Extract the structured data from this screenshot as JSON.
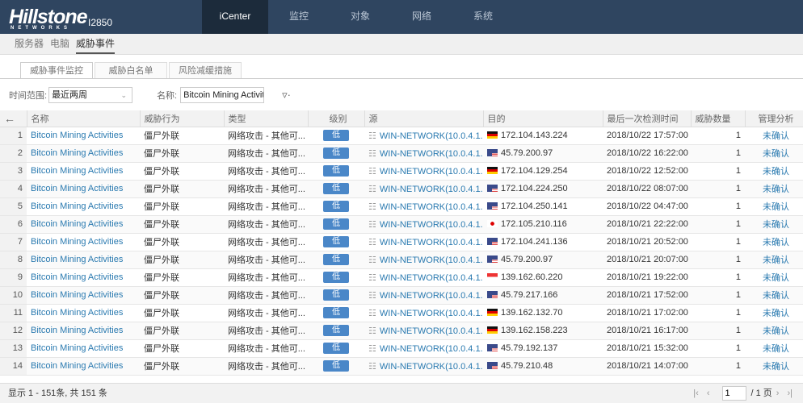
{
  "header": {
    "logo": "Hillstone",
    "logo_sub": "NETWORKS",
    "model": "I2850",
    "nav": [
      "iCenter",
      "监控",
      "对象",
      "网络",
      "系统"
    ],
    "active_nav": 0
  },
  "subnav": {
    "items": [
      "服务器",
      "电脑",
      "威胁事件"
    ],
    "active": 2
  },
  "tabs": {
    "items": [
      "威胁事件监控",
      "威胁白名单",
      "风险减缓措施"
    ],
    "active": 0
  },
  "filter": {
    "time_label": "时间范围:",
    "time_value": "最近两周",
    "name_label": "名称:",
    "name_value": "Bitcoin Mining Activities",
    "filter_icon": "funnel-icon"
  },
  "table": {
    "headers": [
      "名称",
      "威胁行为",
      "类型",
      "级别",
      "源",
      "目的",
      "最后一次检测时间",
      "威胁数量",
      "管理分析"
    ],
    "rows": [
      {
        "n": "1",
        "name": "Bitcoin Mining Activities",
        "behavior": "僵尸外联",
        "type": "网络攻击 - 其他可...",
        "level": "低",
        "src": "WIN-NETWORK(10.0.4.1...",
        "flag": "de",
        "dst": "172.104.143.224",
        "time": "2018/10/22 17:57:00",
        "count": "1",
        "status": "未确认"
      },
      {
        "n": "2",
        "name": "Bitcoin Mining Activities",
        "behavior": "僵尸外联",
        "type": "网络攻击 - 其他可...",
        "level": "低",
        "src": "WIN-NETWORK(10.0.4.1...",
        "flag": "us",
        "dst": "45.79.200.97",
        "time": "2018/10/22 16:22:00",
        "count": "1",
        "status": "未确认"
      },
      {
        "n": "3",
        "name": "Bitcoin Mining Activities",
        "behavior": "僵尸外联",
        "type": "网络攻击 - 其他可...",
        "level": "低",
        "src": "WIN-NETWORK(10.0.4.1...",
        "flag": "de",
        "dst": "172.104.129.254",
        "time": "2018/10/22 12:52:00",
        "count": "1",
        "status": "未确认"
      },
      {
        "n": "4",
        "name": "Bitcoin Mining Activities",
        "behavior": "僵尸外联",
        "type": "网络攻击 - 其他可...",
        "level": "低",
        "src": "WIN-NETWORK(10.0.4.1...",
        "flag": "us",
        "dst": "172.104.224.250",
        "time": "2018/10/22 08:07:00",
        "count": "1",
        "status": "未确认"
      },
      {
        "n": "5",
        "name": "Bitcoin Mining Activities",
        "behavior": "僵尸外联",
        "type": "网络攻击 - 其他可...",
        "level": "低",
        "src": "WIN-NETWORK(10.0.4.1...",
        "flag": "us",
        "dst": "172.104.250.141",
        "time": "2018/10/22 04:47:00",
        "count": "1",
        "status": "未确认"
      },
      {
        "n": "6",
        "name": "Bitcoin Mining Activities",
        "behavior": "僵尸外联",
        "type": "网络攻击 - 其他可...",
        "level": "低",
        "src": "WIN-NETWORK(10.0.4.1...",
        "flag": "jp",
        "dst": "172.105.210.116",
        "time": "2018/10/21 22:22:00",
        "count": "1",
        "status": "未确认"
      },
      {
        "n": "7",
        "name": "Bitcoin Mining Activities",
        "behavior": "僵尸外联",
        "type": "网络攻击 - 其他可...",
        "level": "低",
        "src": "WIN-NETWORK(10.0.4.1...",
        "flag": "us",
        "dst": "172.104.241.136",
        "time": "2018/10/21 20:52:00",
        "count": "1",
        "status": "未确认"
      },
      {
        "n": "8",
        "name": "Bitcoin Mining Activities",
        "behavior": "僵尸外联",
        "type": "网络攻击 - 其他可...",
        "level": "低",
        "src": "WIN-NETWORK(10.0.4.1...",
        "flag": "us",
        "dst": "45.79.200.97",
        "time": "2018/10/21 20:07:00",
        "count": "1",
        "status": "未确认"
      },
      {
        "n": "9",
        "name": "Bitcoin Mining Activities",
        "behavior": "僵尸外联",
        "type": "网络攻击 - 其他可...",
        "level": "低",
        "src": "WIN-NETWORK(10.0.4.1...",
        "flag": "sg",
        "dst": "139.162.60.220",
        "time": "2018/10/21 19:22:00",
        "count": "1",
        "status": "未确认"
      },
      {
        "n": "10",
        "name": "Bitcoin Mining Activities",
        "behavior": "僵尸外联",
        "type": "网络攻击 - 其他可...",
        "level": "低",
        "src": "WIN-NETWORK(10.0.4.1...",
        "flag": "us",
        "dst": "45.79.217.166",
        "time": "2018/10/21 17:52:00",
        "count": "1",
        "status": "未确认"
      },
      {
        "n": "11",
        "name": "Bitcoin Mining Activities",
        "behavior": "僵尸外联",
        "type": "网络攻击 - 其他可...",
        "level": "低",
        "src": "WIN-NETWORK(10.0.4.1...",
        "flag": "de",
        "dst": "139.162.132.70",
        "time": "2018/10/21 17:02:00",
        "count": "1",
        "status": "未确认"
      },
      {
        "n": "12",
        "name": "Bitcoin Mining Activities",
        "behavior": "僵尸外联",
        "type": "网络攻击 - 其他可...",
        "level": "低",
        "src": "WIN-NETWORK(10.0.4.1...",
        "flag": "de",
        "dst": "139.162.158.223",
        "time": "2018/10/21 16:17:00",
        "count": "1",
        "status": "未确认"
      },
      {
        "n": "13",
        "name": "Bitcoin Mining Activities",
        "behavior": "僵尸外联",
        "type": "网络攻击 - 其他可...",
        "level": "低",
        "src": "WIN-NETWORK(10.0.4.1...",
        "flag": "us",
        "dst": "45.79.192.137",
        "time": "2018/10/21 15:32:00",
        "count": "1",
        "status": "未确认"
      },
      {
        "n": "14",
        "name": "Bitcoin Mining Activities",
        "behavior": "僵尸外联",
        "type": "网络攻击 - 其他可...",
        "level": "低",
        "src": "WIN-NETWORK(10.0.4.1...",
        "flag": "us",
        "dst": "45.79.210.48",
        "time": "2018/10/21 14:07:00",
        "count": "1",
        "status": "未确认"
      }
    ]
  },
  "footer": {
    "summary": "显示 1 - 151条, 共 151 条",
    "page": "1",
    "total_pages": "/ 1 页"
  },
  "colors": {
    "header": "#2f4560",
    "link": "#2a7ab0",
    "badge": "#4a87c8"
  }
}
